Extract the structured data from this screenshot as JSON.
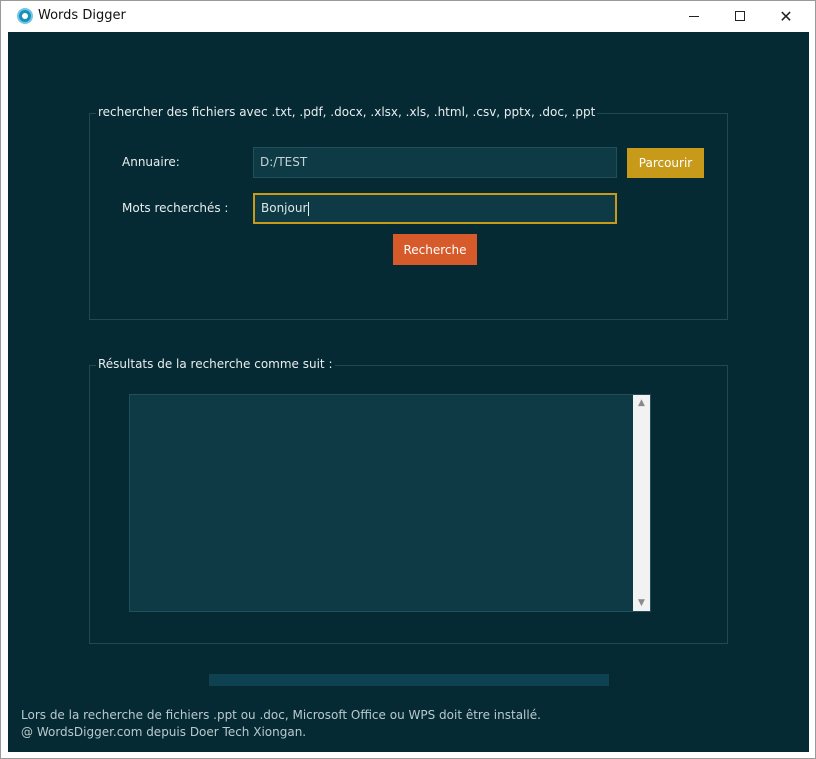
{
  "window": {
    "title": "Words Digger",
    "icon": "app-icon"
  },
  "search_group": {
    "legend": "rechercher des fichiers avec .txt, .pdf, .docx, .xlsx, .xls, .html, .csv, pptx, .doc, .ppt",
    "directory_label": "Annuaire:",
    "directory_value": "D:/TEST",
    "browse_label": "Parcourir",
    "keywords_label": "Mots recherchés :",
    "keywords_value": "Bonjour",
    "search_label": "Recherche"
  },
  "results_group": {
    "legend": "Résultats de la recherche comme suit :",
    "content": ""
  },
  "progress": {
    "value": 0
  },
  "footer": {
    "line1": "Lors de la recherche de fichiers .ppt ou .doc, Microsoft Office ou WPS doit être installé.",
    "line2": "@ WordsDigger.com depuis Doer Tech Xiongan."
  },
  "colors": {
    "background": "#062a33",
    "field": "#0d3a44",
    "browse_button": "#c79a1a",
    "search_button": "#d65a2a",
    "focus_border": "#c79a1a"
  }
}
